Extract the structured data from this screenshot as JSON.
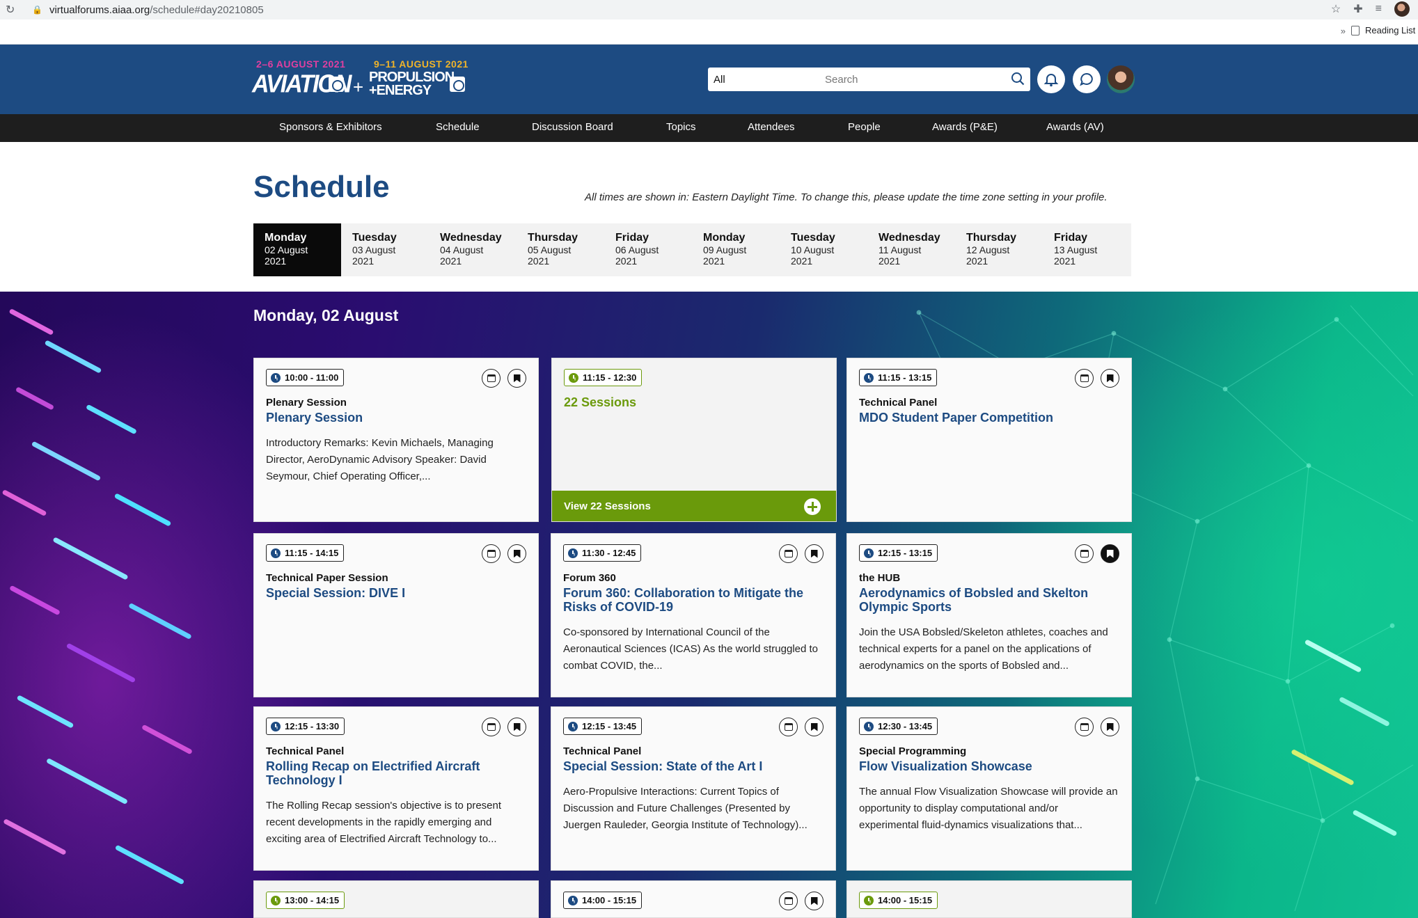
{
  "browser": {
    "url_host": "virtualforums.aiaa.org",
    "url_path": "/schedule#day20210805",
    "bookmarks_more": "»",
    "reading_list": "Reading List"
  },
  "header": {
    "logo": {
      "aviation_dates": "2–6 AUGUST 2021",
      "pe_dates": "9–11 AUGUST 2021",
      "aviation_name": "AVIATION",
      "plus": "+",
      "pe_name_1": "PROPULSION",
      "pe_name_2": "+ENERGY"
    },
    "search": {
      "scope": "All",
      "placeholder": "Search"
    }
  },
  "nav": {
    "items": [
      "Sponsors & Exhibitors",
      "Schedule",
      "Discussion Board",
      "Topics",
      "Attendees",
      "People",
      "Awards (P&E)",
      "Awards (AV)"
    ]
  },
  "schedule": {
    "title": "Schedule",
    "timezone_note": "All times are shown in: Eastern Daylight Time. To change this, please update the time zone setting in your profile.",
    "active_day_index": 0,
    "days": [
      {
        "name": "Monday",
        "date": "02 August",
        "year": "2021"
      },
      {
        "name": "Tuesday",
        "date": "03 August",
        "year": "2021"
      },
      {
        "name": "Wednesday",
        "date": "04 August",
        "year": "2021"
      },
      {
        "name": "Thursday",
        "date": "05 August",
        "year": "2021"
      },
      {
        "name": "Friday",
        "date": "06 August",
        "year": "2021"
      },
      {
        "name": "Monday",
        "date": "09 August",
        "year": "2021"
      },
      {
        "name": "Tuesday",
        "date": "10 August",
        "year": "2021"
      },
      {
        "name": "Wednesday",
        "date": "11 August",
        "year": "2021"
      },
      {
        "name": "Thursday",
        "date": "12 August",
        "year": "2021"
      },
      {
        "name": "Friday",
        "date": "13 August",
        "year": "2021"
      }
    ],
    "section_heading": "Monday, 02 August"
  },
  "cards": [
    {
      "time": "10:00 - 11:00",
      "type": "Plenary Session",
      "title": "Plenary Session",
      "desc": "Introductory Remarks: Kevin Michaels, Managing Director, AeroDynamic Advisory Speaker: David Seymour, Chief Operating Officer,...",
      "bookmarked": false
    },
    {
      "time": "11:15 - 12:30",
      "sessions_title": "22 Sessions",
      "view_label": "View 22 Sessions"
    },
    {
      "time": "11:15 - 13:15",
      "type": "Technical Panel",
      "title": "MDO Student Paper Competition",
      "desc": "",
      "bookmarked": false
    },
    {
      "time": "11:15 - 14:15",
      "type": "Technical Paper Session",
      "title": "Special Session: DIVE I",
      "desc": "",
      "bookmarked": false
    },
    {
      "time": "11:30 - 12:45",
      "type": "Forum 360",
      "title": "Forum 360: Collaboration to Mitigate the Risks of COVID-19",
      "desc": "Co-sponsored by International Council of the Aeronautical Sciences (ICAS) As the world struggled to combat COVID, the...",
      "bookmarked": false
    },
    {
      "time": "12:15 - 13:15",
      "type": "the HUB",
      "title": "Aerodynamics of Bobsled and Skelton Olympic Sports",
      "desc": "Join the USA Bobsled/Skeleton athletes, coaches and technical experts for a panel on the applications of aerodynamics on the sports of Bobsled and...",
      "bookmarked": true
    },
    {
      "time": "12:15 - 13:30",
      "type": "Technical Panel",
      "title": "Rolling Recap on Electrified Aircraft Technology I",
      "desc": "The Rolling Recap session's objective is to present recent developments in the rapidly emerging and exciting area of Electrified Aircraft Technology to...",
      "bookmarked": false
    },
    {
      "time": "12:15 - 13:45",
      "type": "Technical Panel",
      "title": "Special Session: State of the Art I",
      "desc": "Aero-Propulsive Interactions: Current Topics of Discussion and Future Challenges (Presented by Juergen Rauleder, Georgia Institute of Technology)...",
      "bookmarked": false
    },
    {
      "time": "12:30 - 13:45",
      "type": "Special Programming",
      "title": "Flow Visualization Showcase",
      "desc": "The annual Flow Visualization Showcase will provide an opportunity to display computational and/or experimental fluid-dynamics visualizations that...",
      "bookmarked": false
    },
    {
      "time": "13:00 - 14:15"
    },
    {
      "time": "14:00 - 15:15"
    },
    {
      "time": "14:00 - 15:15"
    }
  ]
}
